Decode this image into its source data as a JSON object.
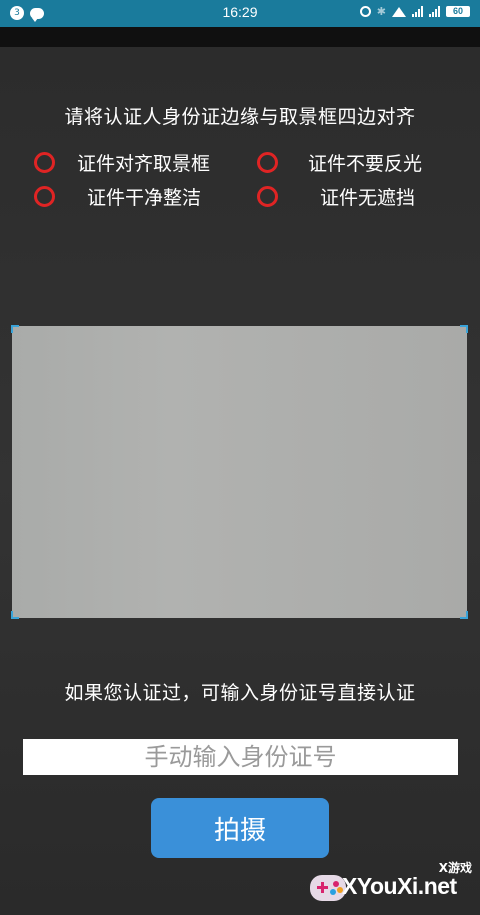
{
  "status_bar": {
    "notification_count": "3",
    "time": "16:29",
    "battery": "60"
  },
  "instruction": "请将认证人身份证边缘与取景框四边对齐",
  "tips": [
    {
      "label": "证件对齐取景框"
    },
    {
      "label": "证件不要反光"
    },
    {
      "label": "证件干净整洁"
    },
    {
      "label": "证件无遮挡"
    }
  ],
  "hint": "如果您认证过，可输入身份证号直接认证",
  "id_input": {
    "placeholder": "手动输入身份证号",
    "value": ""
  },
  "capture_button": {
    "label": "拍摄"
  },
  "watermark": {
    "small_text": "X游戏",
    "text": "XYouXi.net"
  },
  "colors": {
    "status_bar": "#1a7b9c",
    "tip_circle": "#e02424",
    "button": "#3a90d9",
    "viewfinder_corner": "#3aa3d8"
  }
}
